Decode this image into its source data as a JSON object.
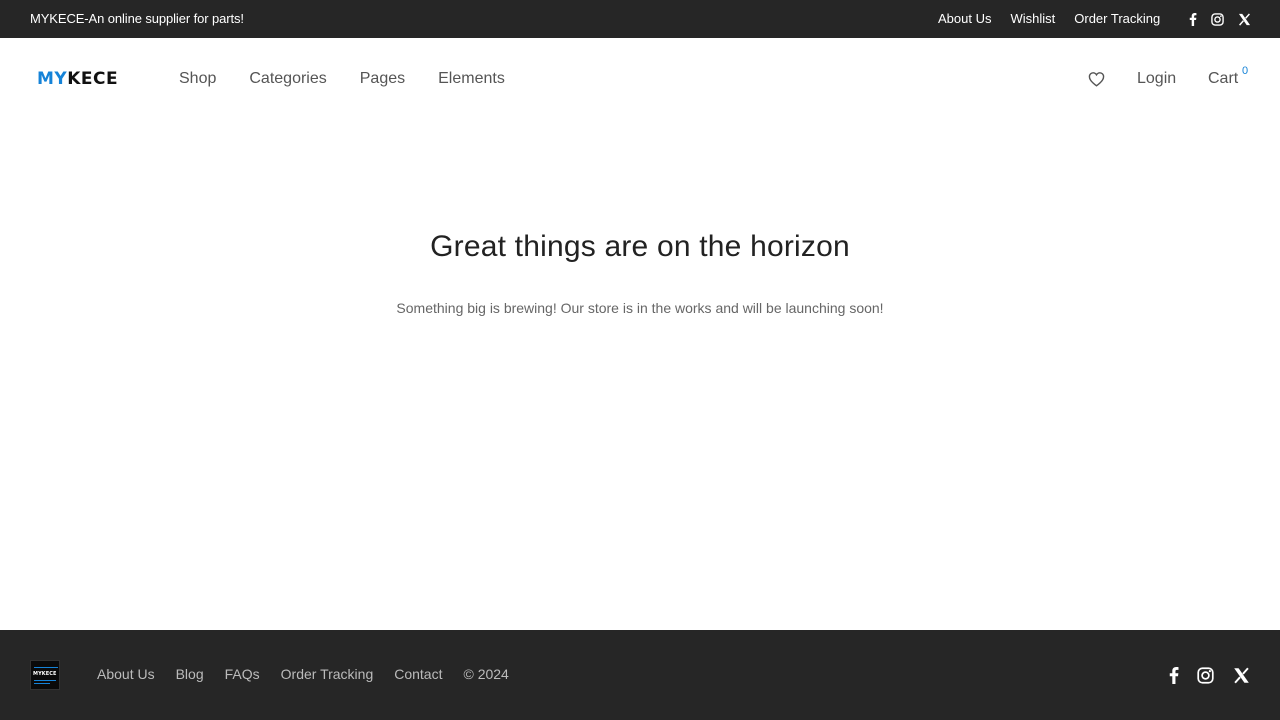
{
  "topbar": {
    "tagline": "MYKECE-An online supplier for parts!",
    "links": [
      "About Us",
      "Wishlist",
      "Order Tracking"
    ],
    "social_icons": [
      "facebook-icon",
      "instagram-icon",
      "x-icon"
    ]
  },
  "header": {
    "logo_part1": "MY",
    "logo_part2": "KECE",
    "nav": [
      "Shop",
      "Categories",
      "Pages",
      "Elements"
    ],
    "wishlist_icon": "heart-icon",
    "login_label": "Login",
    "cart_label": "Cart",
    "cart_count": "0"
  },
  "main": {
    "title": "Great things are on the horizon",
    "subtitle": "Something big is brewing! Our store is in the works and will be launching soon!"
  },
  "footer": {
    "logo_text": "MYKECE",
    "links": [
      "About Us",
      "Blog",
      "FAQs",
      "Order Tracking",
      "Contact"
    ],
    "copyright": "© 2024",
    "social_icons": [
      "facebook-icon",
      "instagram-icon",
      "x-icon"
    ]
  },
  "colors": {
    "accent": "#1583d8",
    "bar_background": "#262626"
  }
}
